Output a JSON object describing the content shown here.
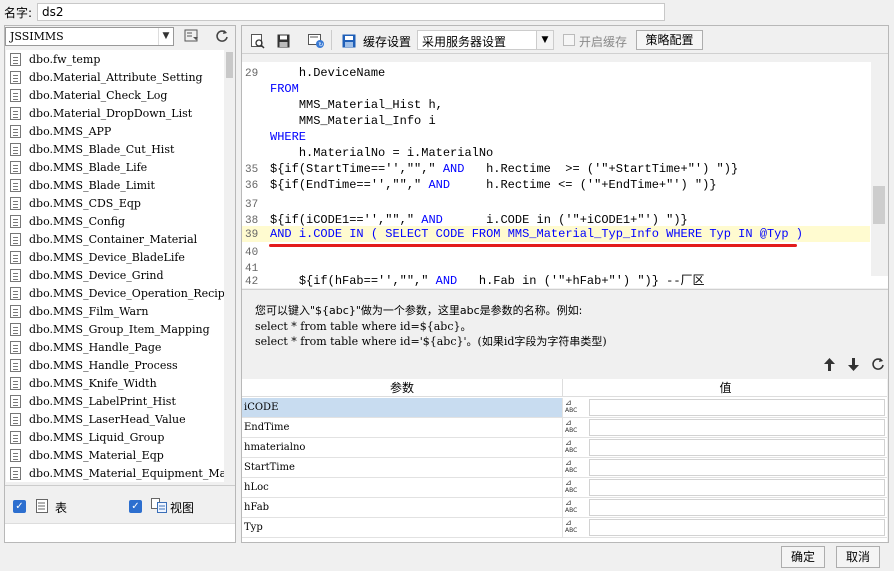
{
  "header": {
    "name_label": "名字:",
    "name_value": "ds2"
  },
  "left": {
    "db_value": "JSSIMMS",
    "tables": [
      "dbo.fw_temp",
      "dbo.Material_Attribute_Setting",
      "dbo.Material_Check_Log",
      "dbo.Material_DropDown_List",
      "dbo.MMS_APP",
      "dbo.MMS_Blade_Cut_Hist",
      "dbo.MMS_Blade_Life",
      "dbo.MMS_Blade_Limit",
      "dbo.MMS_CDS_Eqp",
      "dbo.MMS_Config",
      "dbo.MMS_Container_Material",
      "dbo.MMS_Device_BladeLife",
      "dbo.MMS_Device_Grind",
      "dbo.MMS_Device_Operation_Recipe",
      "dbo.MMS_Film_Warn",
      "dbo.MMS_Group_Item_Mapping",
      "dbo.MMS_Handle_Page",
      "dbo.MMS_Handle_Process",
      "dbo.MMS_Knife_Width",
      "dbo.MMS_LabelPrint_Hist",
      "dbo.MMS_LaserHead_Value",
      "dbo.MMS_Liquid_Group",
      "dbo.MMS_Material_Eqp",
      "dbo.MMS_Material_Equipment_Mappin"
    ],
    "table_check_label": "表",
    "view_check_label": "视图"
  },
  "toolbar": {
    "cache_settings_label": "缓存设置",
    "cache_select_value": "采用服务器设置",
    "enable_cache_label": "开启缓存",
    "strategy_button": "策略配置"
  },
  "editor": {
    "lines": [
      {
        "n": "29",
        "text": "    h.DeviceName"
      },
      {
        "n": "",
        "text": "FROM"
      },
      {
        "n": "",
        "text": "    MMS_Material_Hist h,"
      },
      {
        "n": "",
        "text": "    MMS_Material_Info i"
      },
      {
        "n": "",
        "text": "WHERE"
      },
      {
        "n": "",
        "text": "    h.MaterialNo = i.MaterialNo"
      },
      {
        "n": "35",
        "text": "${if(StartTime=='',\"\",\" AND   h.Rectime  >= ('\"+StartTime+\"') \")}"
      },
      {
        "n": "36",
        "text": "${if(EndTime=='',\"\",\" AND     h.Rectime <= ('\"+EndTime+\"') \")}"
      },
      {
        "n": "37",
        "text": ""
      },
      {
        "n": "38",
        "text": "${if(iCODE1=='',\"\",\" AND      i.CODE in ('\"+iCODE1+\"') \")}"
      },
      {
        "n": "39",
        "text": "AND i.CODE IN ( SELECT CODE FROM MMS_Material_Typ_Info WHERE Typ IN @Typ )"
      },
      {
        "n": "40",
        "text": ""
      },
      {
        "n": "41",
        "text": ""
      },
      {
        "n": "42",
        "text": "    ${if(hFab=='',\"\",\" AND   h.Fab in ('\"+hFab+\"') \")} --厂区"
      }
    ]
  },
  "hint": {
    "line1": "您可以键入\"${abc}\"做为一个参数，这里abc是参数的名称。例如:",
    "line2": "select * from table where id=${abc}。",
    "line3": "select * from table where id='${abc}'。(如果id字段为字符串类型)"
  },
  "params": {
    "header_param": "参数",
    "header_value": "值",
    "type_icon_text": "ABC",
    "rows": [
      "iCODE",
      "EndTime",
      "hmaterialno",
      "StartTime",
      "hLoc",
      "hFab",
      "Typ"
    ]
  },
  "footer": {
    "ok_button": "确定",
    "cancel_button": "取消"
  }
}
